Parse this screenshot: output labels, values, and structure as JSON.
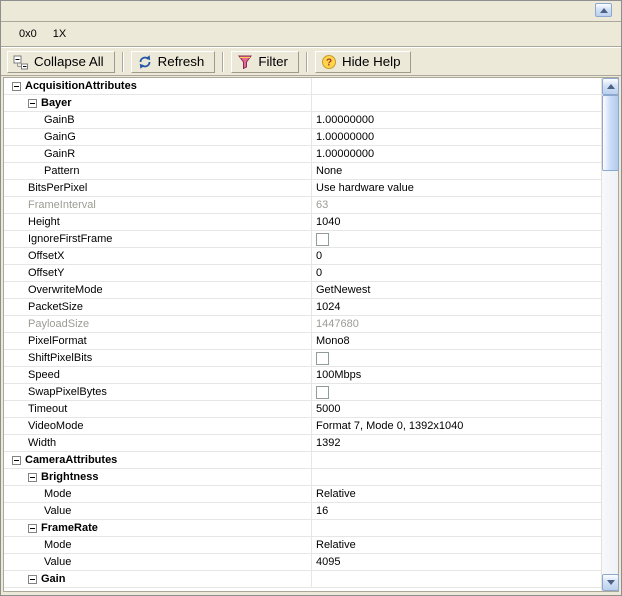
{
  "colors": {
    "window_face": "#ECE9D8",
    "grid_line": "#E6E6E6",
    "disabled_text": "#9C9C94",
    "scrollbar_face": "#C6D8F3",
    "scrollbar_arrow": "#4D6185"
  },
  "image_status_bar": {
    "coordinates": "0x0",
    "zoom": "1X"
  },
  "toolbar": {
    "buttons": [
      {
        "label": "Collapse All",
        "icon": "collapse-all-icon"
      },
      {
        "label": "Refresh",
        "icon": "refresh-icon"
      },
      {
        "label": "Filter",
        "icon": "filter-icon"
      },
      {
        "label": "Hide Help",
        "icon": "hide-help-icon"
      }
    ]
  },
  "property_grid": {
    "rows": [
      {
        "name": "AcquisitionAttributes",
        "value": "",
        "level": 0,
        "kind": "category",
        "expanded": true
      },
      {
        "name": "Bayer",
        "value": "",
        "level": 1,
        "kind": "category",
        "expanded": true
      },
      {
        "name": "GainB",
        "value": "1.00000000",
        "level": 2,
        "kind": "text"
      },
      {
        "name": "GainG",
        "value": "1.00000000",
        "level": 2,
        "kind": "text"
      },
      {
        "name": "GainR",
        "value": "1.00000000",
        "level": 2,
        "kind": "text"
      },
      {
        "name": "Pattern",
        "value": "None",
        "level": 2,
        "kind": "text"
      },
      {
        "name": "BitsPerPixel",
        "value": "Use hardware value",
        "level": 1,
        "kind": "text"
      },
      {
        "name": "FrameInterval",
        "value": "63",
        "level": 1,
        "kind": "text",
        "disabled": true
      },
      {
        "name": "Height",
        "value": "1040",
        "level": 1,
        "kind": "text"
      },
      {
        "name": "IgnoreFirstFrame",
        "value": false,
        "level": 1,
        "kind": "checkbox"
      },
      {
        "name": "OffsetX",
        "value": "0",
        "level": 1,
        "kind": "text"
      },
      {
        "name": "OffsetY",
        "value": "0",
        "level": 1,
        "kind": "text"
      },
      {
        "name": "OverwriteMode",
        "value": "GetNewest",
        "level": 1,
        "kind": "text"
      },
      {
        "name": "PacketSize",
        "value": "1024",
        "level": 1,
        "kind": "text"
      },
      {
        "name": "PayloadSize",
        "value": "1447680",
        "level": 1,
        "kind": "text",
        "disabled": true
      },
      {
        "name": "PixelFormat",
        "value": "Mono8",
        "level": 1,
        "kind": "text"
      },
      {
        "name": "ShiftPixelBits",
        "value": false,
        "level": 1,
        "kind": "checkbox"
      },
      {
        "name": "Speed",
        "value": "100Mbps",
        "level": 1,
        "kind": "text"
      },
      {
        "name": "SwapPixelBytes",
        "value": false,
        "level": 1,
        "kind": "checkbox"
      },
      {
        "name": "Timeout",
        "value": "5000",
        "level": 1,
        "kind": "text"
      },
      {
        "name": "VideoMode",
        "value": "Format 7, Mode 0, 1392x1040",
        "level": 1,
        "kind": "text"
      },
      {
        "name": "Width",
        "value": "1392",
        "level": 1,
        "kind": "text"
      },
      {
        "name": "CameraAttributes",
        "value": "",
        "level": 0,
        "kind": "category",
        "expanded": true
      },
      {
        "name": "Brightness",
        "value": "",
        "level": 1,
        "kind": "category",
        "expanded": true
      },
      {
        "name": "Mode",
        "value": "Relative",
        "level": 2,
        "kind": "text"
      },
      {
        "name": "Value",
        "value": "16",
        "level": 2,
        "kind": "text"
      },
      {
        "name": "FrameRate",
        "value": "",
        "level": 1,
        "kind": "category",
        "expanded": true
      },
      {
        "name": "Mode",
        "value": "Relative",
        "level": 2,
        "kind": "text"
      },
      {
        "name": "Value",
        "value": "4095",
        "level": 2,
        "kind": "text"
      },
      {
        "name": "Gain",
        "value": "",
        "level": 1,
        "kind": "category",
        "expanded": true
      }
    ]
  }
}
